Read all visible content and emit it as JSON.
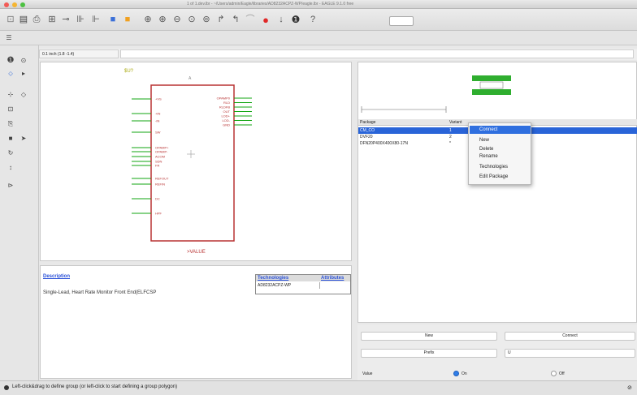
{
  "window": {
    "title": "1 of 1.dev.lbr - ~/Users/admin/Eagle/libraries/AD8232ACPZ-WP/eagle.lbr - EAGLE 9.1.0 free"
  },
  "toolbar": {
    "icons": [
      "open-icon",
      "save-icon",
      "print-icon",
      "cam-icon",
      "board-icon",
      "schematic-icon",
      "library-icon",
      "script-icon",
      "run-icon",
      "zoom-fit-icon",
      "zoom-in-icon",
      "zoom-out-icon",
      "zoom-select-icon",
      "redo-icon",
      "undo-icon",
      "stop-icon",
      "go-icon",
      "info-icon"
    ]
  },
  "coord": {
    "value": "0.1 inch (1.8 -1.4)"
  },
  "symbol": {
    "name": "$U?",
    "gate": "A",
    "value": ">VALUE",
    "pins_left": [
      "+VS",
      "+IN",
      "-IN",
      "SW",
      "OPAMP+",
      "OPAMP-",
      "ACOM",
      "SDN",
      "FR",
      "REFOUT",
      "REFIN",
      "DC",
      "HPF"
    ],
    "pins_right": [
      "OPAMP0",
      "RLD",
      "RLDFB",
      "OUT",
      "LOD+",
      "LOD-",
      "GND"
    ],
    "pin_colors": {
      "pin": "#11a511",
      "body": "#b83232",
      "label": "#b83232"
    }
  },
  "description": {
    "header": "Description",
    "text": "Single-Lead, Heart Rate Monitor Front End(ELFCSP"
  },
  "tech_table": {
    "headers": [
      "Technologies",
      "Attributes"
    ],
    "row": [
      "AD8232ACPZ-WP",
      ""
    ]
  },
  "package_list": {
    "headers": [
      "Package",
      "Variant"
    ],
    "rows": [
      {
        "name": "CM_CO",
        "variant": "1",
        "selected": true
      },
      {
        "name": "DVF20",
        "variant": "2",
        "selected": false
      },
      {
        "name": "DFN20P400X400X80-17N",
        "variant": "*",
        "selected": false
      }
    ]
  },
  "context_menu": {
    "items": [
      "Connect",
      "New",
      "Delete",
      "Rename",
      "Technologies",
      "Edit Package"
    ]
  },
  "bottom": {
    "new_label": "New",
    "connect_label": "Connect",
    "prefix_label": "Prefix",
    "prefix_value": "U",
    "value_label": "Value",
    "on_label": "On",
    "off_label": "Off"
  },
  "status": {
    "text": "Left-click&drag to define group (or left-click to start defining a group polygon)"
  }
}
